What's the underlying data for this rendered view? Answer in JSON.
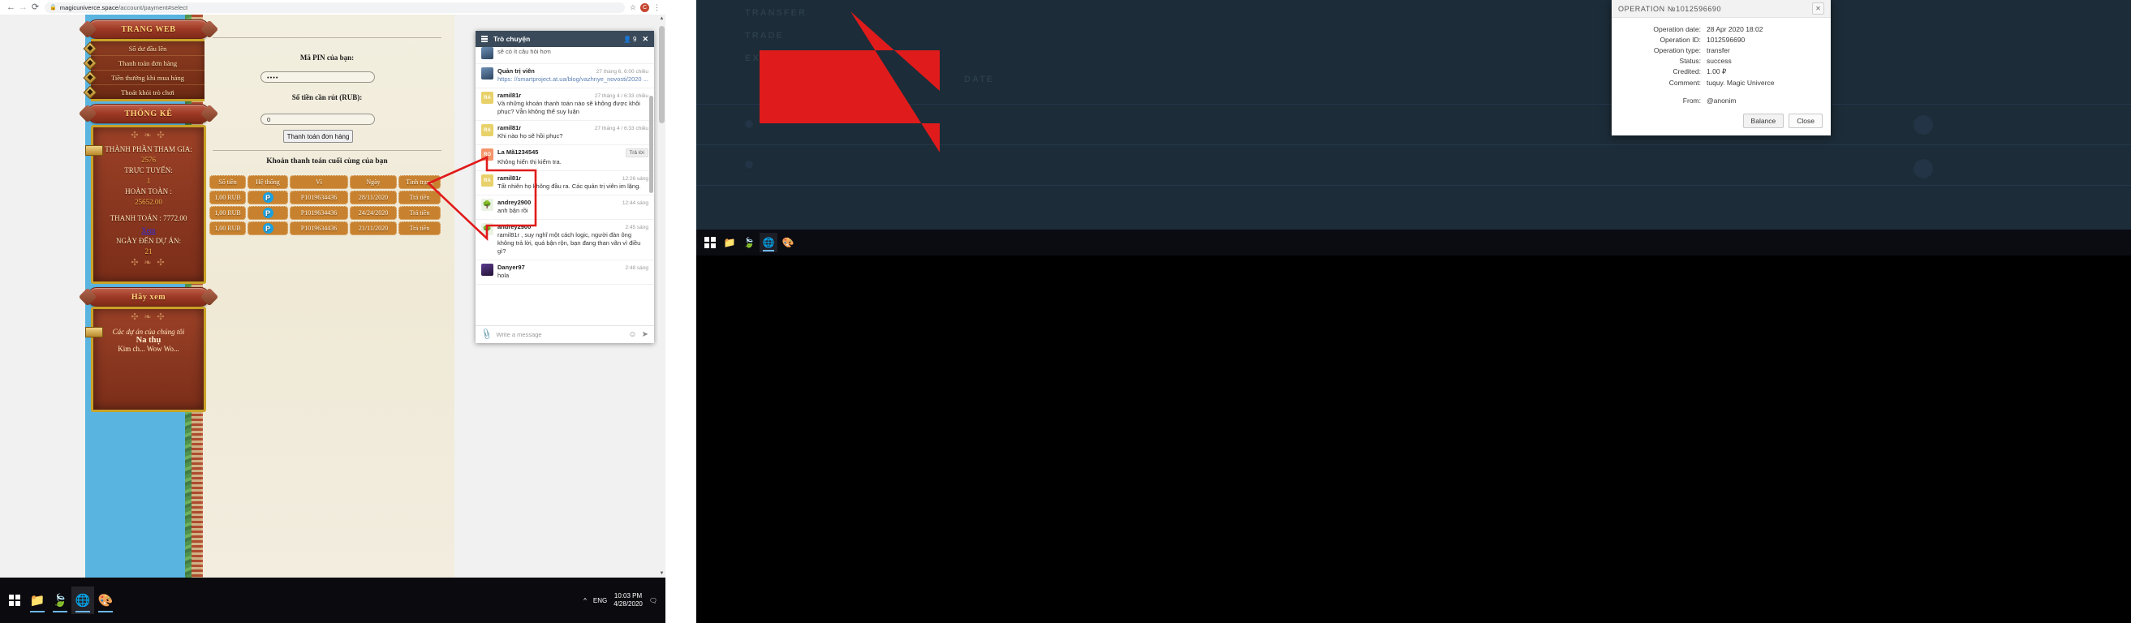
{
  "browser": {
    "url_prefix": "magicuniverce.space",
    "url_suffix": "/account/payment#select",
    "back_icon": "back-arrow-icon",
    "forward_icon": "forward-arrow-icon",
    "reload_icon": "reload-icon",
    "lock_icon": "lock-icon",
    "star_icon": "star-icon",
    "profile_initial": "C",
    "menu_icon": "kebab-menu-icon"
  },
  "game": {
    "banner_website": "TRANG WEB",
    "banner_stats": "THỐNG KÊ",
    "banner_look": "Hãy xem",
    "menu": [
      {
        "label": "Số dư đầu lên"
      },
      {
        "label": "Thanh toán đơn hàng"
      },
      {
        "label": "Tiền thưởng khi mua hàng"
      },
      {
        "label": "Thoát khỏi trò chơi"
      }
    ],
    "stats": {
      "participants_label": "THÀNH PHẦN THAM GIA:",
      "participants_value": "2576",
      "online_label": "TRỰC TUYẾN:",
      "online_value": "1",
      "total_label": "HOÀN TOÀN :",
      "total_value": "25652.00",
      "payment_label": "THANH TOÁN : 7772.00",
      "view_link": "Xem",
      "days_label": "NGÀY ĐẾN DỰ ÁN:",
      "days_value": "21"
    },
    "projects": {
      "line1": "Các dự án của chúng tôi",
      "line2": "Na thụ",
      "line3": "Kim ch... Wow Wo..."
    }
  },
  "payment_form": {
    "pin_label": "Mã PIN của bạn:",
    "pin_value": "••••",
    "amount_label": "Số tiền cần rút (RUB):",
    "amount_value": "0",
    "submit_label": "Thanh toán đơn hàng",
    "table_title": "Khoản thanh toán cuối cùng của bạn",
    "columns": [
      "Số tiền",
      "Hệ thống",
      "Ví",
      "Ngày",
      "Tình trạng"
    ],
    "rows": [
      {
        "amount": "1,00 RUB",
        "system": "P",
        "wallet": "P1019634436",
        "date": "28/11/2020",
        "status": "Trả tiền"
      },
      {
        "amount": "1,00 RUB",
        "system": "P",
        "wallet": "P1019634436",
        "date": "24/24/2020",
        "status": "Trả tiền"
      },
      {
        "amount": "1,00 RUB",
        "system": "P",
        "wallet": "P1019634436",
        "date": "21/11/2020",
        "status": "Trả tiền"
      }
    ]
  },
  "chat": {
    "title": "Trò chuyện",
    "user_count": "9",
    "close_icon": "close-icon",
    "menu_icon": "hamburger-icon",
    "users_icon": "users-icon",
    "input_placeholder": "Write a message",
    "attach_icon": "paperclip-icon",
    "emoji_icon": "smiley-icon",
    "send_icon": "send-icon",
    "reply_label": "Trả lời",
    "messages": [
      {
        "name": "",
        "time": "",
        "text": "sẽ có ít câu hỏi hơn",
        "avatar": "admin",
        "partial": true
      },
      {
        "name": "Quản trị viên",
        "time": "27 tháng 6, 6:00 chiều",
        "text": "https: //smartproject.at.ua/blog/vazhnye_novosti/2020 ...",
        "avatar": "admin",
        "link": true
      },
      {
        "name": "ramil81r",
        "time": "27 tháng 4 / 6:33 chiều",
        "text": "Và những khoản thanh toán nào sẽ không được khôi phục? Vẫn không thể suy luận",
        "avatar": "ra"
      },
      {
        "name": "ramil81r",
        "time": "27 tháng 4 / 6:33 chiều",
        "text": "Khi nào họ sẽ hồi phục?",
        "avatar": "ra"
      },
      {
        "name": "La Mã1234545",
        "time": "",
        "text": "Không hiến thị kiểm tra.",
        "avatar": "ro",
        "has_reply": true
      },
      {
        "name": "ramil81r",
        "time": "12:26 sáng",
        "text": "Tất nhiên họ không đầu ra. Các quản trị viên im lặng.",
        "avatar": "ra"
      },
      {
        "name": "andrey2900",
        "time": "12:44 sáng",
        "text": "anh bận rồi",
        "avatar": "tree"
      },
      {
        "name": "andrey2900",
        "time": "2:45 sáng",
        "text": "ramil81r , suy nghĩ một cách logic, người đàn ông không trả lời, quá bận rộn, bạn đang than vãn vì điều gì?",
        "avatar": "tree"
      },
      {
        "name": "Danyer97",
        "time": "2:48 sáng",
        "text": "hola",
        "avatar": "dan"
      }
    ]
  },
  "taskbar": {
    "start_icon": "windows-start-icon",
    "explorer_icon": "file-explorer-icon",
    "app_icon": "leaf-app-icon",
    "chrome_icon": "chrome-icon",
    "paint_icon": "paint-icon",
    "tray_arrow_icon": "show-hidden-icons-icon",
    "language": "ENG",
    "time": "10:03 PM",
    "date": "4/28/2020",
    "notification_icon": "notifications-icon"
  },
  "dialog": {
    "title": "OPERATION №1012596690",
    "close_icon": "close-icon",
    "fields": [
      {
        "key": "Operation date:",
        "value": "28 Apr 2020 18:02"
      },
      {
        "key": "Operation ID:",
        "value": "1012596690"
      },
      {
        "key": "Operation type:",
        "value": "transfer"
      },
      {
        "key": "Status:",
        "value": "success"
      },
      {
        "key": "Credited:",
        "value": "1.00 ₽"
      },
      {
        "key": "Comment:",
        "value": "tuquy. Magic Univerce"
      }
    ],
    "from_key": "From:",
    "from_value": "@anonim",
    "balance_label": "Balance",
    "close_label": "Close"
  },
  "right_desktop": {
    "ghost_labels": [
      "TRANSFER",
      "TRADE",
      "EXCHANGE",
      "DATE"
    ],
    "taskbar_icons": [
      "windows-start-icon",
      "file-explorer-icon",
      "leaf-app-icon",
      "chrome-icon",
      "paint-icon"
    ]
  },
  "colors": {
    "accent_orange": "#c8822f",
    "chat_header": "#3a4a5a",
    "arrow_red": "#e01b1b",
    "wood": "#8a3720"
  }
}
